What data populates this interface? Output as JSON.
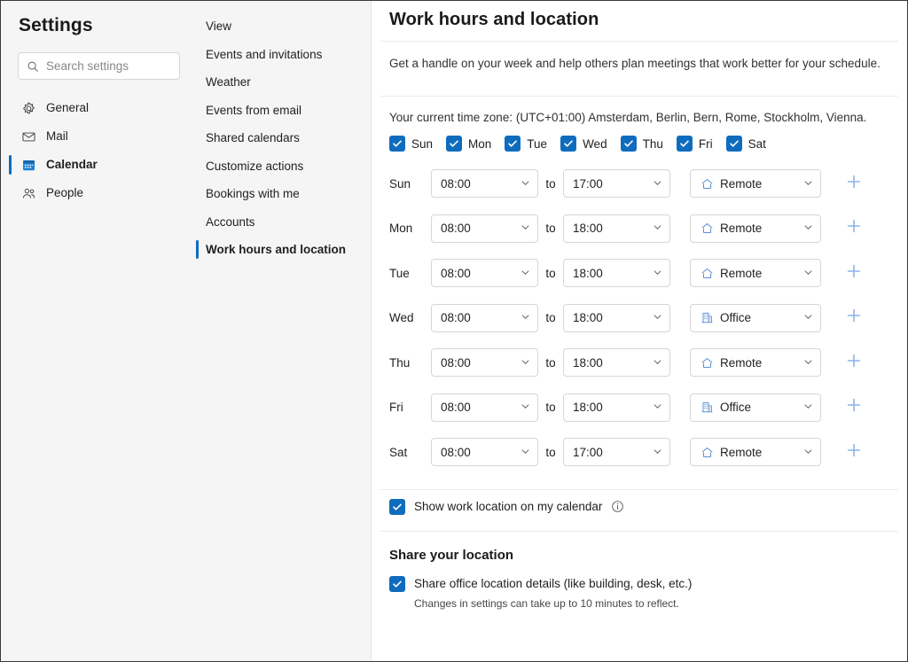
{
  "sidebar": {
    "title": "Settings",
    "search": {
      "placeholder": "Search settings",
      "value": "",
      "icon": "search-icon"
    },
    "items": [
      {
        "label": "General",
        "icon": "gear-icon",
        "active": false
      },
      {
        "label": "Mail",
        "icon": "envelope-icon",
        "active": false
      },
      {
        "label": "Calendar",
        "icon": "calendar-icon",
        "active": true
      },
      {
        "label": "People",
        "icon": "people-icon",
        "active": false
      }
    ]
  },
  "subnav": {
    "items": [
      {
        "label": "View",
        "active": false
      },
      {
        "label": "Events and invitations",
        "active": false
      },
      {
        "label": "Weather",
        "active": false
      },
      {
        "label": "Events from email",
        "active": false
      },
      {
        "label": "Shared calendars",
        "active": false
      },
      {
        "label": "Customize actions",
        "active": false
      },
      {
        "label": "Bookings with me",
        "active": false
      },
      {
        "label": "Accounts",
        "active": false
      },
      {
        "label": "Work hours and location",
        "active": true
      }
    ]
  },
  "main": {
    "title": "Work hours and location",
    "intro": "Get a handle on your week and help others plan meetings that work better for your schedule.",
    "timezone_text": "Your current time zone: (UTC+01:00) Amsterdam, Berlin, Bern, Rome, Stockholm, Vienna.",
    "to_word": "to",
    "add_icon": "plus-icon",
    "day_toggles": [
      {
        "label": "Sun",
        "checked": true
      },
      {
        "label": "Mon",
        "checked": true
      },
      {
        "label": "Tue",
        "checked": true
      },
      {
        "label": "Wed",
        "checked": true
      },
      {
        "label": "Thu",
        "checked": true
      },
      {
        "label": "Fri",
        "checked": true
      },
      {
        "label": "Sat",
        "checked": true
      }
    ],
    "schedule": [
      {
        "day": "Sun",
        "start": "08:00",
        "end": "17:00",
        "location": "Remote",
        "location_icon": "home-icon"
      },
      {
        "day": "Mon",
        "start": "08:00",
        "end": "18:00",
        "location": "Remote",
        "location_icon": "home-icon"
      },
      {
        "day": "Tue",
        "start": "08:00",
        "end": "18:00",
        "location": "Remote",
        "location_icon": "home-icon"
      },
      {
        "day": "Wed",
        "start": "08:00",
        "end": "18:00",
        "location": "Office",
        "location_icon": "building-icon"
      },
      {
        "day": "Thu",
        "start": "08:00",
        "end": "18:00",
        "location": "Remote",
        "location_icon": "home-icon"
      },
      {
        "day": "Fri",
        "start": "08:00",
        "end": "18:00",
        "location": "Office",
        "location_icon": "building-icon"
      },
      {
        "day": "Sat",
        "start": "08:00",
        "end": "17:00",
        "location": "Remote",
        "location_icon": "home-icon"
      }
    ],
    "show_work_location": {
      "label": "Show work location on my calendar",
      "checked": true,
      "info_icon": "info-icon"
    },
    "share_section": {
      "heading": "Share your location",
      "checkbox_label": "Share office location details (like building, desk, etc.)",
      "checked": true,
      "note": "Changes in settings can take up to 10 minutes to reflect."
    }
  },
  "colors": {
    "accent": "#0f6cbd",
    "checkbox_fill": "#0f6cbd",
    "plus": "#8ab4e8",
    "panel_bg": "#f5f5f5",
    "border": "#d6d6d6",
    "divider": "#ebebeb"
  }
}
